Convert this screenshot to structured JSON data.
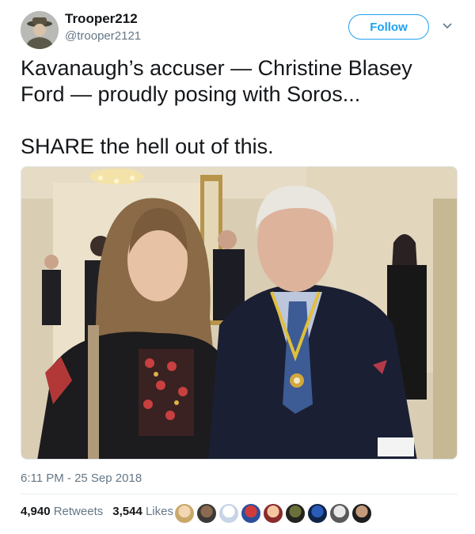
{
  "author": {
    "display_name": "Trooper212",
    "handle": "@trooper2121"
  },
  "follow_label": "Follow",
  "tweet": {
    "text": "Kavanaugh’s accuser — Christine Blasey\nFord — proudly posing with Soros...\n\nSHARE the hell out of this."
  },
  "timestamp": "6:11 PM - 25 Sep 2018",
  "stats": {
    "retweets_count": "4,940",
    "retweets_label": "Retweets",
    "likes_count": "3,544",
    "likes_label": "Likes"
  },
  "colors": {
    "accent": "#1da1f2",
    "muted": "#657786"
  }
}
